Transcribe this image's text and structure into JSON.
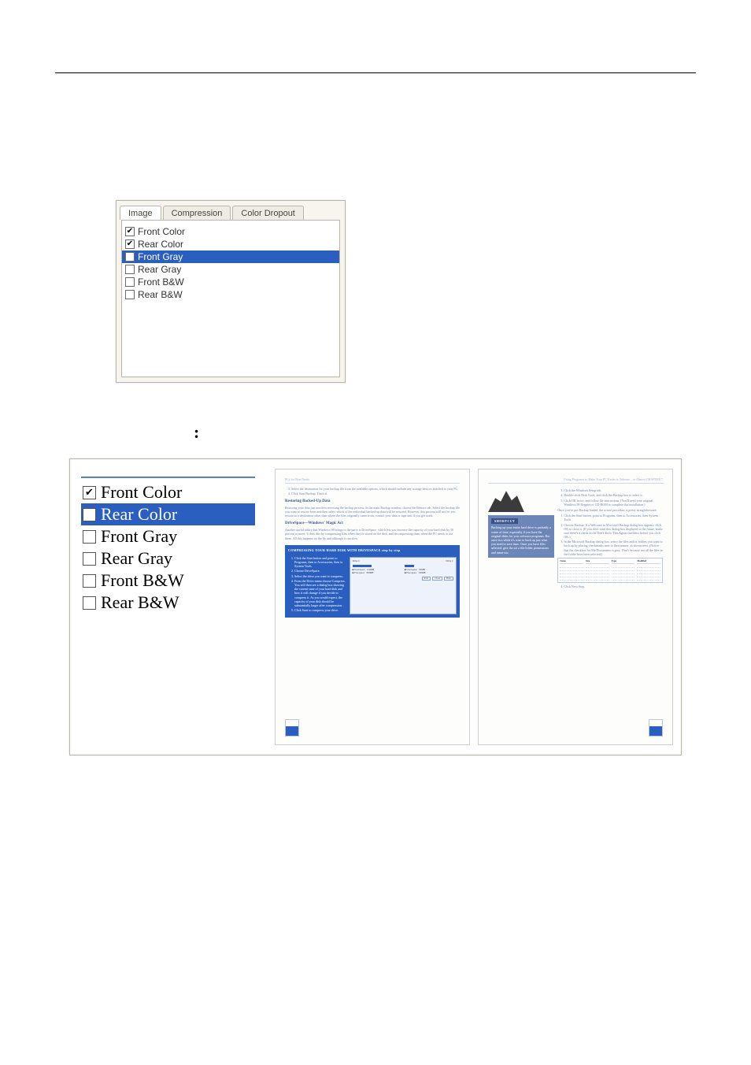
{
  "tabs": {
    "image": "Image",
    "compression": "Compression",
    "color_dropout": "Color Dropout"
  },
  "options": {
    "front_color": "Front Color",
    "rear_color": "Rear Color",
    "front_gray": "Front Gray",
    "rear_gray": "Rear Gray",
    "front_bw": "Front B&W",
    "rear_bw": "Rear B&W"
  },
  "option_states": {
    "front_color": true,
    "rear_color": true,
    "front_gray": false,
    "rear_gray": false,
    "front_bw": false,
    "rear_bw": false,
    "selected": "front_gray"
  },
  "colon": ":",
  "zoom_selected": "rear_color",
  "left_page": {
    "header_left": "PCs for Non-Nerds",
    "heading_restoring": "Restoring Backed-Up Data",
    "restoring_text": "Restoring your data just involves reversing the backup process. In the main Backup window, choose the Restore tab. Select the backup file you want to restore from and then select which of the individual backed-up data will be restored. However, this process will not let you restore to a destination other than where the files originally came from; contact your data or tape unit if you get stuck.",
    "step3": "Select the destination for your backup file from the available options, which should include any storage devices attached to your PC.",
    "step4": "Click Start Backup. That's it.",
    "heading_drivespace": "DriveSpace—Windows' Magic Act",
    "drivespace_text": "Another useful utility that Windows 98 brings to the party is DriveSpace, which lets you increase the capacity of your hard disk by 50 percent or more. It does this by compressing files when they're stored on the disk, and decompressing them when the PC needs to use them. All this happens on the fly and although it can slow",
    "comp_title": "COMPRESSING YOUR HARD DISK WITH DRIVESPACE step by step",
    "comp_steps": {
      "s1": "Click the Start button and point to Programs, then to Accessories, then to System Tools.",
      "s2": "Choose DriveSpace.",
      "s3": "Select the drive you want to compress.",
      "s4": "From the Drive menu choose Compress. You will then see a dialog box showing the current state of your hard disk and how it will change if you decide to compress it. As you would expect, the capacity of your disk should be substantially larger after compression.",
      "s5": "Click Start to compress your drive."
    }
  },
  "right_page": {
    "header_right": "Using Programs to Make Your PC Easier to Tolerate…or Almost  CHAPTER 7",
    "step3r": "Click the Windows Setup tab.",
    "step4r": "Double-click Disk Tools, and click the Backup box to select it.",
    "step5r": "Click OK twice, and follow the instructions. (You'll need your original Windows 98 floppies or CD-ROM to complete this installation.)",
    "once_intro": "Once you've got Backup loaded, the actual procedure is pretty straightforward:",
    "r1": "Click the Start button, point to Programs, then to Accessories, then System Tools.",
    "r2": "Choose Backup. If a Welcome to Microsoft Backup dialog box appears, click OK to close it. (If you don't want this dialog box displayed in the future, make sure there's a check in the Don't Show This Again checkbox before you click OK.)",
    "r3": "In the Microsoft Backup dialog box, select the files and/or folders you want to back up by placing checkmarks next to their names, as shown next. (Notice that the checkbox for My Documents is grey. That's because not all the files in the folder have been selected.)",
    "r4": "Click Next Step.",
    "shortcut_title": "SHORTCUT",
    "shortcut_text": "Backing up your entire hard drive is probably a waste of time, especially if you have the original disks for your software programs. But once in a while it's wise to back up just what you need to save time. Once you have files selected, give the set a file/folder permissions and name too."
  }
}
